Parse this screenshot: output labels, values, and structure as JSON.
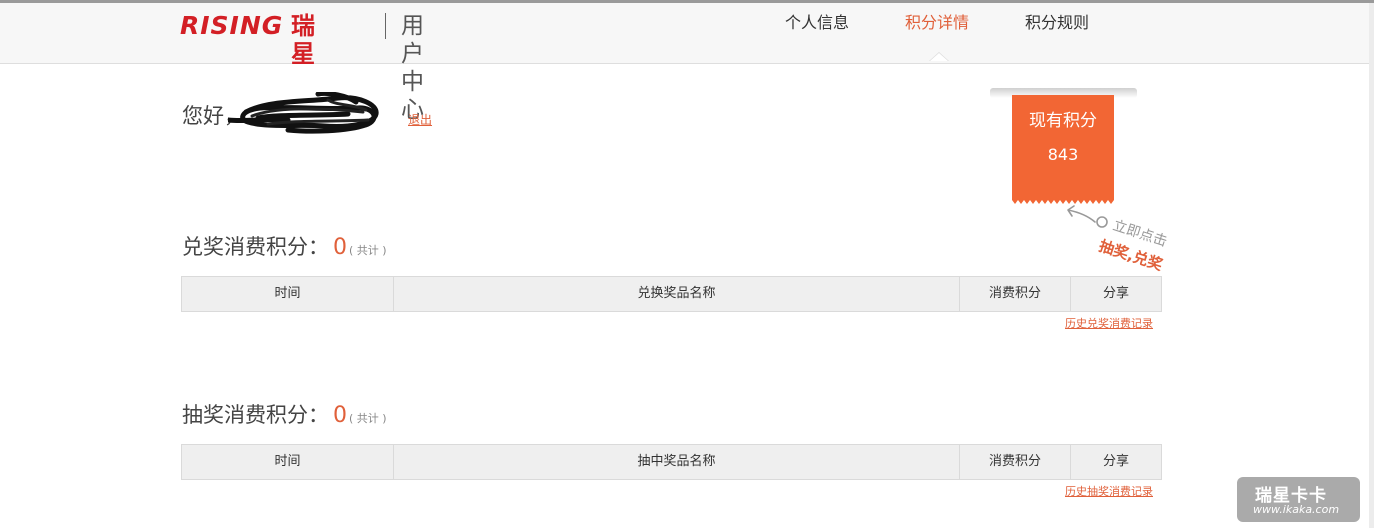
{
  "header": {
    "logo_en": "RISING",
    "logo_cn": "瑞星",
    "subtitle": "用户中心",
    "nav": [
      {
        "label": "个人信息",
        "active": false
      },
      {
        "label": "积分详情",
        "active": true
      },
      {
        "label": "积分规则",
        "active": false
      }
    ]
  },
  "user": {
    "greeting": "您好，",
    "logout_label": "退出"
  },
  "points_badge": {
    "title": "现有积分",
    "value": "843",
    "hint_line1": "立即点击",
    "hint_line2": "抽奖,兑奖"
  },
  "redeem_section": {
    "title": "兑奖消费积分：",
    "total_value": "0",
    "total_label": "( 共计 )",
    "columns": [
      "时间",
      "兑换奖品名称",
      "消费积分",
      "分享"
    ],
    "history_link": "历史兑奖消费记录"
  },
  "lottery_section": {
    "title": "抽奖消费积分：",
    "total_value": "0",
    "total_label": "( 共计 )",
    "columns": [
      "时间",
      "抽中奖品名称",
      "消费积分",
      "分享"
    ],
    "history_link": "历史抽奖消费记录"
  },
  "watermark": {
    "brand": "瑞星卡卡",
    "url": "www.ikaka.com"
  },
  "colors": {
    "accent": "#e0603a",
    "badge": "#f26634",
    "logo_red": "#d31f25"
  }
}
